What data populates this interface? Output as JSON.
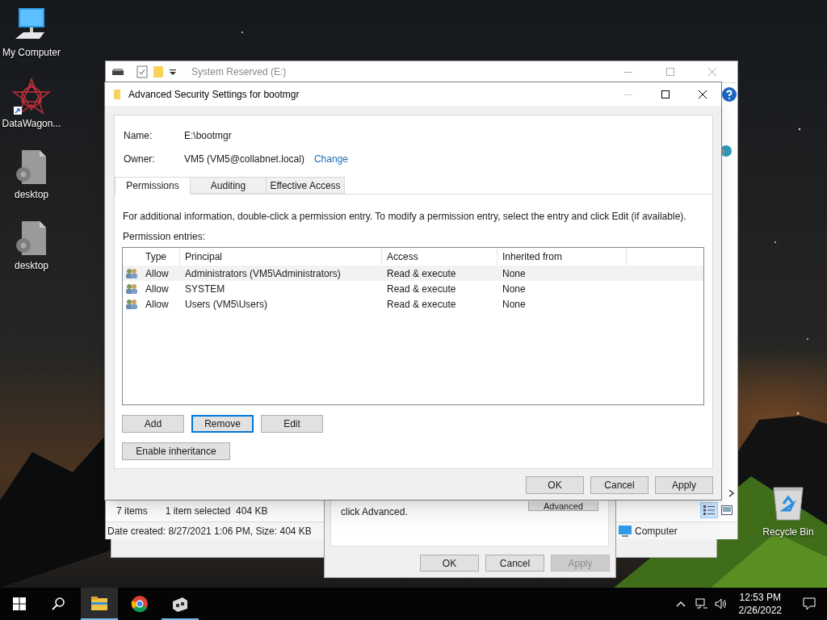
{
  "desktop_icons": [
    {
      "kind": "computer",
      "label": "My Computer"
    },
    {
      "kind": "app",
      "label": "DataWagon..."
    },
    {
      "kind": "file",
      "label": "desktop"
    },
    {
      "kind": "file",
      "label": "desktop"
    }
  ],
  "recycle_bin": {
    "label": "Recycle Bin"
  },
  "explorer": {
    "title": "System Reserved (E:)",
    "item_count": "7 items",
    "selection": "1 item selected  404 KB",
    "details": "Date created: 8/27/2021 1:06 PM, Size: 404 KB",
    "location": "Computer"
  },
  "security_tab": {
    "text": "click Advanced.",
    "advanced_button": "Advanced",
    "buttons": [
      {
        "label": "OK",
        "disabled": false
      },
      {
        "label": "Cancel",
        "disabled": false
      },
      {
        "label": "Apply",
        "disabled": true
      }
    ]
  },
  "dialog": {
    "title": "Advanced Security Settings for bootmgr",
    "name_label": "Name:",
    "name_value": "E:\\bootmgr",
    "owner_label": "Owner:",
    "owner_value": "VM5 (VM5@collabnet.local)",
    "change_link": "Change",
    "tabs": [
      {
        "label": "Permissions",
        "selected": true
      },
      {
        "label": "Auditing",
        "selected": false
      },
      {
        "label": "Effective Access",
        "selected": false
      }
    ],
    "info": "For additional information, double-click a permission entry. To modify a permission entry, select the entry and click Edit (if available).",
    "entries_label": "Permission entries:",
    "columns": [
      "Type",
      "Principal",
      "Access",
      "Inherited from"
    ],
    "rows": [
      {
        "type": "Allow",
        "principal": "Administrators (VM5\\Administrators)",
        "access": "Read & execute",
        "inherited_from": "None",
        "selected": true
      },
      {
        "type": "Allow",
        "principal": "SYSTEM",
        "access": "Read & execute",
        "inherited_from": "None",
        "selected": false
      },
      {
        "type": "Allow",
        "principal": "Users (VM5\\Users)",
        "access": "Read & execute",
        "inherited_from": "None",
        "selected": false
      }
    ],
    "entry_buttons": [
      {
        "label": "Add",
        "focused": false
      },
      {
        "label": "Remove",
        "focused": true
      },
      {
        "label": "Edit",
        "focused": false
      }
    ],
    "inheritance_button": "Enable inheritance",
    "footer_buttons": [
      "OK",
      "Cancel",
      "Apply"
    ]
  },
  "taskbar": {
    "apps": [
      {
        "kind": "folder",
        "running": true,
        "active": true
      },
      {
        "kind": "browser",
        "running": false,
        "active": false
      },
      {
        "kind": "device",
        "running": true,
        "active": false
      }
    ],
    "time": "12:53 PM",
    "date": "2/26/2022"
  }
}
